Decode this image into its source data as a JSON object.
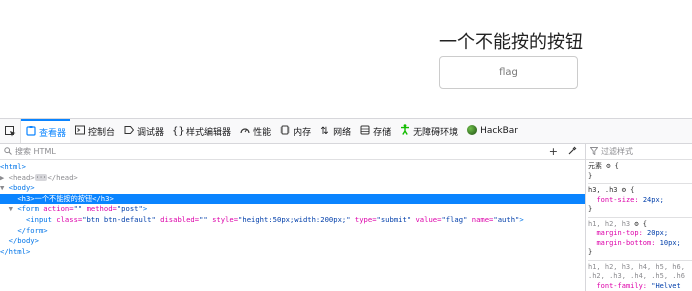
{
  "page": {
    "title": "一个不能按的按钮",
    "button_label": "flag"
  },
  "devtools": {
    "tabs": [
      {
        "icon": "inspector-icon",
        "glyph": "⬚",
        "label": "查看器"
      },
      {
        "icon": "console-icon",
        "glyph": "▸",
        "label": "控制台"
      },
      {
        "icon": "debugger-icon",
        "glyph": "▷",
        "label": "调试器"
      },
      {
        "icon": "style-editor-icon",
        "glyph": "{}",
        "label": "样式编辑器"
      },
      {
        "icon": "performance-icon",
        "glyph": "◠",
        "label": "性能"
      },
      {
        "icon": "memory-icon",
        "glyph": "▥",
        "label": "内存"
      },
      {
        "icon": "network-icon",
        "glyph": "⇅",
        "label": "网络"
      },
      {
        "icon": "storage-icon",
        "glyph": "▤",
        "label": "存储"
      },
      {
        "icon": "accessibility-icon",
        "glyph": "♿",
        "label": "无障碍环境"
      },
      {
        "icon": "hackbar-icon",
        "glyph": "●",
        "label": "HackBar"
      }
    ],
    "search_placeholder": "搜索 HTML",
    "filter_placeholder": "过滤样式",
    "markup": {
      "l0": "<html>",
      "l1_open": "<head>",
      "l1_dots": "···",
      "l1_close": "</head>",
      "l2": "<body>",
      "l3_open": "<h3>",
      "l3_text": "一个不能按的按钮",
      "l3_close": "</h3>",
      "l4_tag": "<form",
      "l4_a1": "action=",
      "l4_v1": "\"\"",
      "l4_a2": "method=",
      "l4_v2": "\"post\"",
      "l4_end": ">",
      "l5_tag": "<input",
      "l5_a1": "class=",
      "l5_v1": "\"btn btn-default\"",
      "l5_a2": "disabled=",
      "l5_v2": "\"\"",
      "l5_a3": "style=",
      "l5_v3": "\"height:50px;width:200px;\"",
      "l5_a4": "type=",
      "l5_v4": "\"submit\"",
      "l5_a5": "value=",
      "l5_v5": "\"flag\"",
      "l5_a6": "name=",
      "l5_v6": "\"auth\"",
      "l5_end": ">",
      "l6": "</form>",
      "l7": "</body>",
      "l8": "</html>"
    },
    "rules": {
      "element_label": "元素",
      "r1_selector": "h3, .h3",
      "r1_prop": "font-size:",
      "r1_val": "24px;",
      "r2_selector": "h1, h2, h3",
      "r2_prop1": "margin-top:",
      "r2_val1": "20px;",
      "r2_prop2": "margin-bottom:",
      "r2_val2": "10px;",
      "r3_selector_line1": "h1, h2, h3, h4, h5, h6,",
      "r3_selector_line2": ".h2, .h3, .h4, .h5, .h6",
      "r3_prop": "font-family:",
      "r3_val": "\"Helvet"
    }
  }
}
